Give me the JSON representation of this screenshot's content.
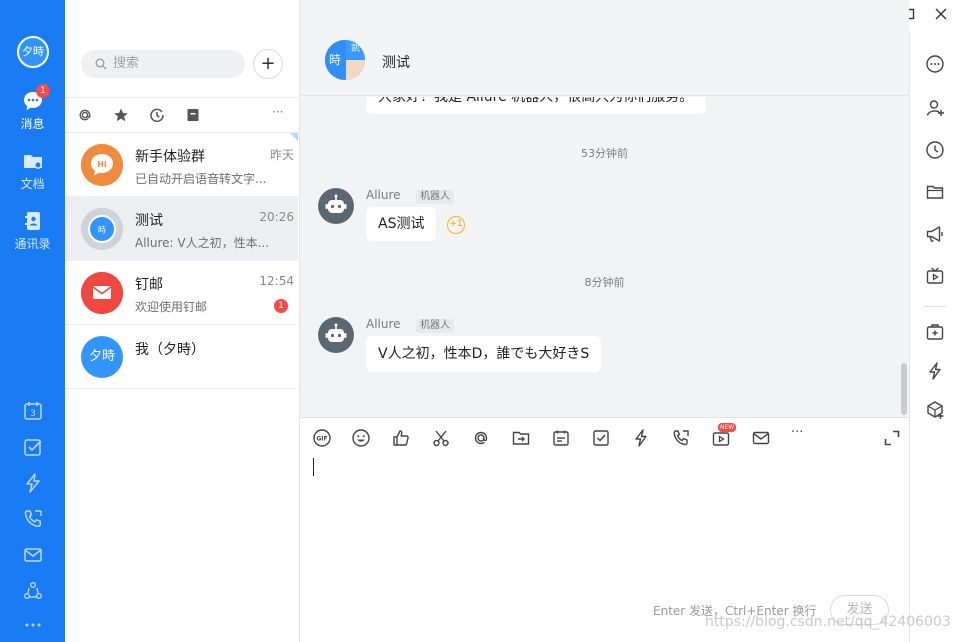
{
  "window": {
    "min_icon": "minimize-icon",
    "max_icon": "maximize-icon",
    "close_icon": "close-icon"
  },
  "rail": {
    "avatar_text": "夕時",
    "items": [
      {
        "label": "消息",
        "icon": "chat-bubble-icon",
        "badge": "1"
      },
      {
        "label": "文档",
        "icon": "folder-icon"
      },
      {
        "label": "通讯录",
        "icon": "contacts-icon"
      }
    ],
    "bottom_icons": [
      "calendar-icon",
      "todo-icon",
      "lightning-icon",
      "phone-icon",
      "mail-icon",
      "workflow-icon",
      "more-icon"
    ],
    "calendar_day": "3",
    "accent": "#1a7cf5"
  },
  "search": {
    "placeholder": "搜索",
    "add_label": "+"
  },
  "filters": [
    "at-icon",
    "star-icon",
    "clock-icon",
    "archive-icon",
    "more-icon"
  ],
  "filters_more": "···",
  "conversations": [
    {
      "name": "新手体验群",
      "time": "昨天",
      "preview": "已自动开启语音转文字...",
      "avatar": "Hi"
    },
    {
      "name": "测试",
      "time": "20:26",
      "preview": "Allure: V人之初，性本...",
      "avatar": "時"
    },
    {
      "name": "钉邮",
      "time": "12:54",
      "preview": "欢迎使用钉邮",
      "badge": "1"
    },
    {
      "name": "我（夕時）",
      "avatar": "夕時"
    }
  ],
  "chat": {
    "title": "测试",
    "group_avatar": {
      "left": "時",
      "right_top": "凯"
    },
    "messages": [
      {
        "type": "text",
        "text": "大家好！我是 Allure 机器人，很高兴为你们服务。"
      },
      {
        "type": "time",
        "text": "53分钟前"
      },
      {
        "type": "msg",
        "sender": "Allure",
        "tag": "机器人",
        "text": "AS测试",
        "reaction": "+1"
      },
      {
        "type": "time",
        "text": "8分钟前"
      },
      {
        "type": "msg",
        "sender": "Allure",
        "tag": "机器人",
        "text": "V人之初，性本D，誰でも大好きS"
      }
    ]
  },
  "composer": {
    "tools": [
      "gif-icon",
      "emoji-icon",
      "thumbs-up-icon",
      "scissors-icon",
      "at-icon",
      "forward-icon",
      "calendar-event-icon",
      "checkbox-icon",
      "lightning-icon",
      "video-call-icon",
      "live-icon",
      "mail-icon",
      "more-icon"
    ],
    "gif_label": "GIF",
    "new_tag": "NEW",
    "more_label": "···",
    "hint": "Enter 发送，Ctrl+Enter 换行",
    "send_label": "发送"
  },
  "right_bar": [
    "more-circle-icon",
    "add-member-icon",
    "history-icon",
    "folder-icon",
    "announcement-icon",
    "tv-icon",
    "add-app-icon",
    "lightning-icon",
    "cube-plus-icon"
  ],
  "watermark": "https://blog.csdn.net/qq_42406003"
}
